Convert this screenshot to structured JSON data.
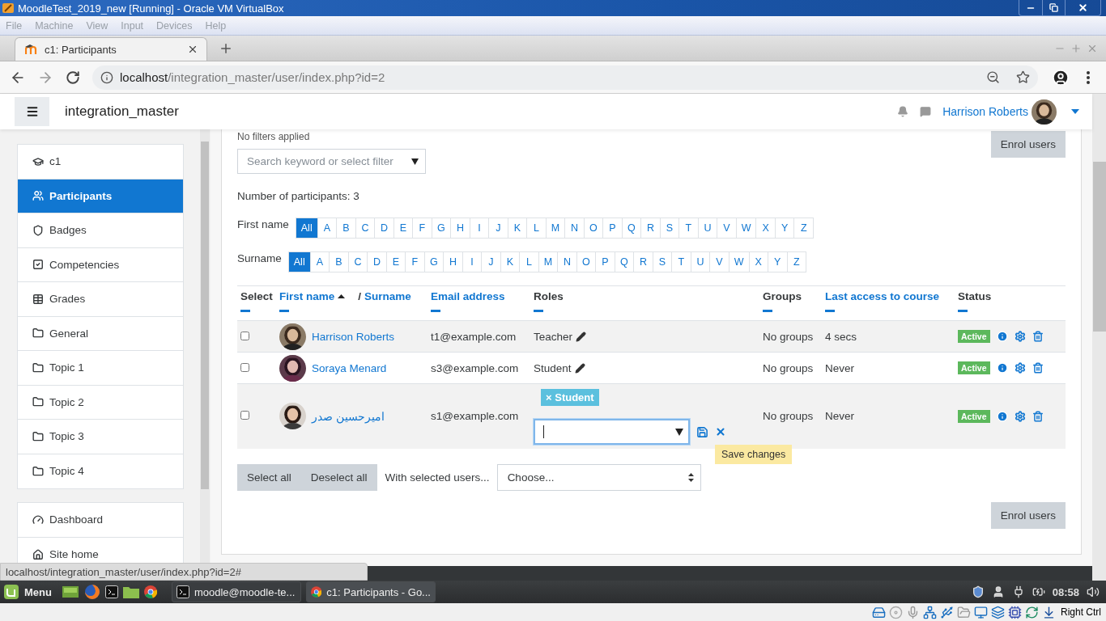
{
  "vm_window": {
    "title": "MoodleTest_2019_new [Running] - Oracle VM VirtualBox",
    "menu": [
      "File",
      "Machine",
      "View",
      "Input",
      "Devices",
      "Help"
    ]
  },
  "browser": {
    "tabs": [
      {
        "label": "c1: Participants",
        "selected": true
      }
    ],
    "url": {
      "host": "localhost",
      "path": "/integration_master/user/index.php?id=2"
    },
    "status_url": "localhost/integration_master/user/index.php?id=2#"
  },
  "navbar": {
    "site_name": "integration_master",
    "user_name": "Harrison Roberts"
  },
  "drawer": {
    "sections": [
      {
        "items": [
          {
            "label": "c1",
            "kind": "course",
            "selected": false
          },
          {
            "label": "Participants",
            "kind": "participants",
            "selected": true
          },
          {
            "label": "Badges",
            "kind": "badges",
            "selected": false
          },
          {
            "label": "Competencies",
            "kind": "competencies",
            "selected": false
          },
          {
            "label": "Grades",
            "kind": "grades",
            "selected": false
          },
          {
            "label": "General",
            "kind": "section",
            "selected": false
          },
          {
            "label": "Topic 1",
            "kind": "section",
            "selected": false
          },
          {
            "label": "Topic 2",
            "kind": "section",
            "selected": false
          },
          {
            "label": "Topic 3",
            "kind": "section",
            "selected": false
          },
          {
            "label": "Topic 4",
            "kind": "section",
            "selected": false
          }
        ]
      },
      {
        "items": [
          {
            "label": "Dashboard",
            "kind": "dashboard",
            "selected": false
          },
          {
            "label": "Site home",
            "kind": "home",
            "selected": false
          }
        ]
      }
    ]
  },
  "content": {
    "filters_note": "No filters applied",
    "enrol_buttons": [
      "Enrol users",
      "Enrol users"
    ],
    "search": {
      "placeholder": "Search keyword or select filter"
    },
    "count": "Number of participants: 3",
    "initials_bars": [
      {
        "label": "First name",
        "letters": [
          {
            "label": "All",
            "selected": true
          },
          {
            "label": "A",
            "selected": false
          },
          {
            "label": "B",
            "selected": false
          },
          {
            "label": "C",
            "selected": false
          },
          {
            "label": "D",
            "selected": false
          },
          {
            "label": "E",
            "selected": false
          },
          {
            "label": "F",
            "selected": false
          },
          {
            "label": "G",
            "selected": false
          },
          {
            "label": "H",
            "selected": false
          },
          {
            "label": "I",
            "selected": false
          },
          {
            "label": "J",
            "selected": false
          },
          {
            "label": "K",
            "selected": false
          },
          {
            "label": "L",
            "selected": false
          },
          {
            "label": "M",
            "selected": false
          },
          {
            "label": "N",
            "selected": false
          },
          {
            "label": "O",
            "selected": false
          },
          {
            "label": "P",
            "selected": false
          },
          {
            "label": "Q",
            "selected": false
          },
          {
            "label": "R",
            "selected": false
          },
          {
            "label": "S",
            "selected": false
          },
          {
            "label": "T",
            "selected": false
          },
          {
            "label": "U",
            "selected": false
          },
          {
            "label": "V",
            "selected": false
          },
          {
            "label": "W",
            "selected": false
          },
          {
            "label": "X",
            "selected": false
          },
          {
            "label": "Y",
            "selected": false
          },
          {
            "label": "Z",
            "selected": false
          }
        ]
      },
      {
        "label": "Surname",
        "letters": [
          {
            "label": "All",
            "selected": true
          },
          {
            "label": "A",
            "selected": false
          },
          {
            "label": "B",
            "selected": false
          },
          {
            "label": "C",
            "selected": false
          },
          {
            "label": "D",
            "selected": false
          },
          {
            "label": "E",
            "selected": false
          },
          {
            "label": "F",
            "selected": false
          },
          {
            "label": "G",
            "selected": false
          },
          {
            "label": "H",
            "selected": false
          },
          {
            "label": "I",
            "selected": false
          },
          {
            "label": "J",
            "selected": false
          },
          {
            "label": "K",
            "selected": false
          },
          {
            "label": "L",
            "selected": false
          },
          {
            "label": "M",
            "selected": false
          },
          {
            "label": "N",
            "selected": false
          },
          {
            "label": "O",
            "selected": false
          },
          {
            "label": "P",
            "selected": false
          },
          {
            "label": "Q",
            "selected": false
          },
          {
            "label": "R",
            "selected": false
          },
          {
            "label": "S",
            "selected": false
          },
          {
            "label": "T",
            "selected": false
          },
          {
            "label": "U",
            "selected": false
          },
          {
            "label": "V",
            "selected": false
          },
          {
            "label": "W",
            "selected": false
          },
          {
            "label": "X",
            "selected": false
          },
          {
            "label": "Y",
            "selected": false
          },
          {
            "label": "Z",
            "selected": false
          }
        ]
      }
    ],
    "table": {
      "columns": [
        {
          "label": "Select",
          "link": false
        },
        {
          "label": "First name",
          "link": true,
          "sorted": true,
          "secondary": {
            "separator": "/",
            "label": "Surname"
          }
        },
        {
          "label": "Email address",
          "link": true
        },
        {
          "label": "Roles",
          "link": false
        },
        {
          "label": "Groups",
          "link": false
        },
        {
          "label": "Last access to course",
          "link": true
        },
        {
          "label": "Status",
          "link": false
        }
      ],
      "rows": [
        {
          "checked": false,
          "name": "Harrison Roberts",
          "email": "t1@example.com",
          "editing": false,
          "roles": [
            {
              "label": "Teacher"
            }
          ],
          "groups": "No groups",
          "last_access": "4 secs",
          "status": "Active"
        },
        {
          "checked": false,
          "name": "Soraya Menard",
          "email": "s3@example.com",
          "editing": false,
          "roles": [
            {
              "label": "Student"
            }
          ],
          "groups": "No groups",
          "last_access": "Never",
          "status": "Active"
        },
        {
          "checked": false,
          "name": "امیرحسین صدر",
          "email": "s1@example.com",
          "editing": true,
          "roles": [
            {
              "label": "Student",
              "remove": "×"
            }
          ],
          "tooltip": "Save changes",
          "groups": "No groups",
          "last_access": "Never",
          "status": "Active"
        }
      ]
    },
    "bulk": {
      "select_all": "Select all",
      "deselect_all": "Deselect all",
      "label": "With selected users...",
      "choose": "Choose..."
    }
  },
  "taskbar": {
    "menu_label": "Menu",
    "tasks": [
      {
        "label": "moodle@moodle-te...",
        "kind": "terminal",
        "selected": false
      },
      {
        "label": "c1: Participants - Go...",
        "kind": "browser",
        "selected": true
      }
    ],
    "clock": "08:58"
  },
  "vbox_status": {
    "host_key": "Right Ctrl"
  }
}
